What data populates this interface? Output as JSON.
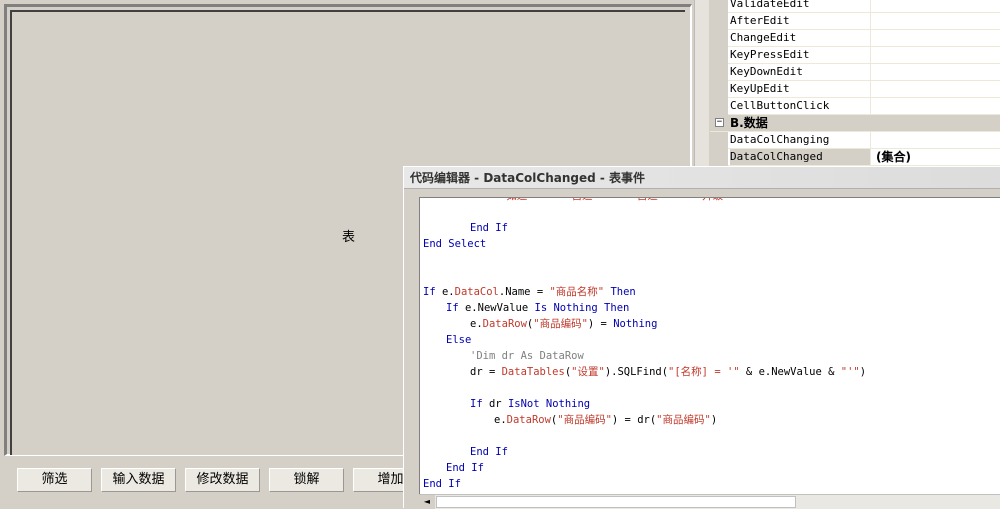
{
  "designer": {
    "table_label": "表",
    "buttons": [
      "筛选",
      "输入数据",
      "修改数据",
      "锁解",
      "增加"
    ]
  },
  "propgrid": {
    "rows": [
      {
        "name": "ValidateEdit",
        "value": ""
      },
      {
        "name": "AfterEdit",
        "value": ""
      },
      {
        "name": "ChangeEdit",
        "value": ""
      },
      {
        "name": "KeyPressEdit",
        "value": ""
      },
      {
        "name": "KeyDownEdit",
        "value": ""
      },
      {
        "name": "KeyUpEdit",
        "value": ""
      },
      {
        "name": "CellButtonClick",
        "value": ""
      }
    ],
    "category": {
      "expander": "−",
      "label": "B.数据"
    },
    "rows2": [
      {
        "name": "DataColChanging",
        "value": ""
      },
      {
        "name": "DataColChanged",
        "value": "(集合)"
      }
    ]
  },
  "editor": {
    "title": "代码编辑器 - DataColChanged - 表事件",
    "scroll_left": "◄"
  },
  "code": {
    "l0": "End If",
    "l1": "End Select",
    "l2a": "If",
    "l2b": " e.",
    "l2c": "DataCol",
    "l2d": ".Name = ",
    "l2e": "\"商品名称\"",
    "l2f": " Then",
    "l3a": "If",
    "l3b": " e.NewValue ",
    "l3c": "Is Nothing Then",
    "l4a": "e.",
    "l4b": "DataRow",
    "l4c": "(",
    "l4d": "\"商品编码\"",
    "l4e": ") = ",
    "l4f": "Nothing",
    "l5": "Else",
    "l6": "'Dim dr As DataRow",
    "l7a": "dr = ",
    "l7b": "DataTables",
    "l7c": "(",
    "l7d": "\"设置\"",
    "l7e": ").SQLFind(",
    "l7f": "\"[名称] = '\"",
    "l7g": " & e.NewValue & ",
    "l7h": "\"'\"",
    "l7i": ")",
    "l8a": "If",
    "l8b": " dr ",
    "l8c": "IsNot Nothing",
    "l9a": "e.",
    "l9b": "DataRow",
    "l9c": "(",
    "l9d": "\"商品编码\"",
    "l9e": ") = dr(",
    "l9f": "\"商品编码\"",
    "l9g": ")",
    "l10": "End If",
    "l11": "End If",
    "l12": "End If"
  }
}
